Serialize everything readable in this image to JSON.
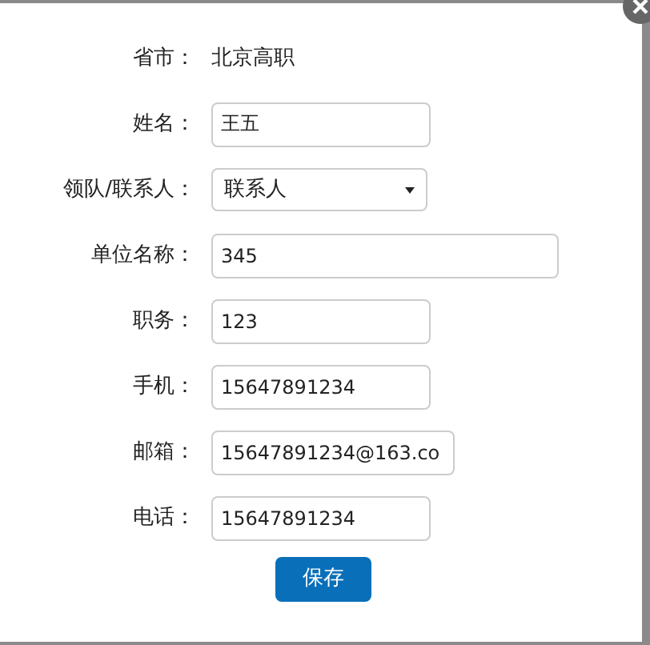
{
  "fields": [
    {
      "label": "省市：",
      "kind": "text",
      "value": "北京高职"
    },
    {
      "label": "姓名：",
      "kind": "input",
      "value": "王五",
      "wide": false
    },
    {
      "label": "领队/联系人：",
      "kind": "select",
      "value": "联系人"
    },
    {
      "label": "单位名称：",
      "kind": "input",
      "value": "345",
      "wide": true
    },
    {
      "label": "职务：",
      "kind": "input",
      "value": "123",
      "wide": false
    },
    {
      "label": "手机：",
      "kind": "input",
      "value": "15647891234",
      "wide": false
    },
    {
      "label": "邮箱：",
      "kind": "input",
      "value": "15647891234@163.co",
      "wide": false
    },
    {
      "label": "电话：",
      "kind": "input",
      "value": "15647891234",
      "wide": false
    }
  ],
  "save_button": "保存"
}
